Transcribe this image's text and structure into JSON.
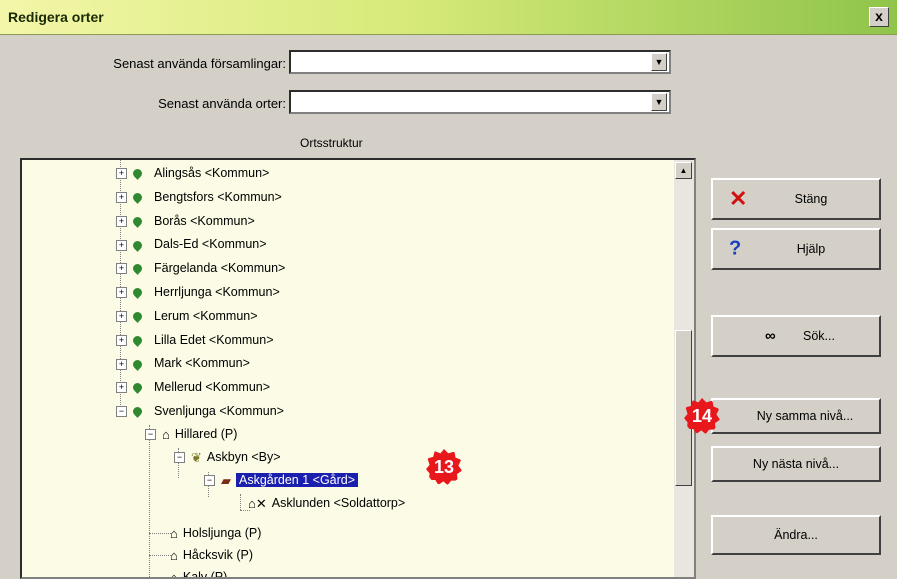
{
  "window": {
    "title": "Redigera orter",
    "close_label": "x"
  },
  "fields": {
    "forsamlingar": {
      "label": "Senast använda församlingar:",
      "value": ""
    },
    "orter": {
      "label": "Senast använda orter:",
      "value": ""
    }
  },
  "tree": {
    "header": "Ortsstruktur",
    "kommuner": [
      "Alingsås <Kommun>",
      "Bengtsfors <Kommun>",
      "Borås <Kommun>",
      "Dals-Ed <Kommun>",
      "Färgelanda <Kommun>",
      "Herrljunga <Kommun>",
      "Lerum <Kommun>",
      "Lilla Edet <Kommun>",
      "Mark <Kommun>",
      "Mellerud <Kommun>",
      "Svenljunga <Kommun>"
    ],
    "hillared": "Hillared (P)",
    "askbyn": "Askbyn <By>",
    "askgarden": "Askgården 1 <Gård>",
    "asklunden": "Asklunden <Soldattorp>",
    "holsljunga": "Holsljunga (P)",
    "hacksvik": "Håcksvik (P)",
    "kalv": "Kalv (P)"
  },
  "buttons": {
    "stang": "Stäng",
    "hjalp": "Hjälp",
    "sok": "Sök...",
    "ny_samma": "Ny samma nivå...",
    "ny_nasta": "Ny nästa nivå...",
    "andra": "Ändra..."
  },
  "badges": {
    "b13": "13",
    "b14": "14"
  },
  "icons": {
    "stang": "red-x-icon",
    "hjalp": "question-icon",
    "sok": "binoculars-icon"
  }
}
